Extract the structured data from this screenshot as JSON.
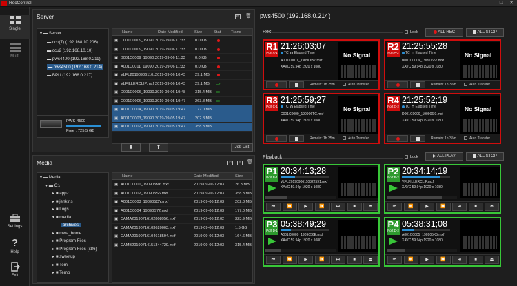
{
  "app": {
    "title": "RecControl"
  },
  "nav": {
    "single": "Single",
    "multi": "Multi",
    "settings": "Settings",
    "help": "Help",
    "exit": "Exit"
  },
  "server": {
    "title": "Server",
    "tree": [
      "Server",
      "ccu(7) (192.168.10.206)",
      "ccu2 (192.168.10.10)",
      "pws4400 (192.168.0.211)",
      "pws4500 (192.168.0.214)",
      "BPU (192.168.0.217)"
    ],
    "device_name": "PWS-4500",
    "device_free": "Free : 725.5 GB",
    "columns": [
      "Name",
      "Date Modified",
      "Size",
      "Stat",
      "Trans"
    ],
    "rows": [
      {
        "name": "D001C0009_19090...",
        "date": "2019-09-06 11:33",
        "size": "0.0 KB",
        "stat": "red",
        "sel": false
      },
      {
        "name": "C001C0009_19090...",
        "date": "2019-09-06 11:33",
        "size": "0.0 KB",
        "stat": "red",
        "sel": false
      },
      {
        "name": "B001C0009_19090...",
        "date": "2019-09-06 11:33",
        "size": "0.0 KB",
        "stat": "red",
        "sel": false
      },
      {
        "name": "A001C0011_19090...",
        "date": "2019-09-06 11:33",
        "size": "0.0 KB",
        "stat": "red",
        "sel": false
      },
      {
        "name": "VLFL20190906110...",
        "date": "2019-09-06 10:43",
        "size": "29.1 MB",
        "stat": "red",
        "sel": false
      },
      {
        "name": "VLFILLERCLIP.mxf",
        "date": "2019-09-06 10:43",
        "size": "29.1 MB",
        "stat": "green",
        "sel": false
      },
      {
        "name": "D001C0006_19090...",
        "date": "2019-09-06 19:48",
        "size": "315.4 MB",
        "stat": "green",
        "sel": false
      },
      {
        "name": "C001C0006_19090...",
        "date": "2019-09-05 19:47",
        "size": "263.8 MB",
        "stat": "green",
        "sel": false
      },
      {
        "name": "A001C0004_19090...",
        "date": "2019-09-05 19:47",
        "size": "177.0 MB",
        "stat": "",
        "sel": true
      },
      {
        "name": "A001C0003_19090...",
        "date": "2019-09-05 19:47",
        "size": "202.8 MB",
        "stat": "",
        "sel": true
      },
      {
        "name": "A001C0002_19090...",
        "date": "2019-09-05 19:47",
        "size": "358.3 MB",
        "stat": "",
        "sel": true
      }
    ],
    "down_arrow": "⬇",
    "up_arrow": "⬆",
    "job_list": "Job List"
  },
  "media": {
    "title": "Media",
    "tree": [
      "Media",
      "C:\\",
      "appz",
      "jenkins",
      "Logs",
      "media",
      "archives",
      "mwa_home",
      "Program Files",
      "Program Files (x86)",
      "swsetup",
      "Tem",
      "Temp"
    ],
    "columns": [
      "Name",
      "Date Modified",
      "Size"
    ],
    "rows": [
      {
        "name": "A001C0001_190905M6.mxf",
        "date": "2019-09-06 12:03",
        "size": "26.3 MB"
      },
      {
        "name": "A001C0002_190905S6.mxf",
        "date": "2019-09-06 12:03",
        "size": "358.3 MB"
      },
      {
        "name": "A001C0003_190905QY.mxf",
        "date": "2019-09-06 12:03",
        "size": "202.8 MB"
      },
      {
        "name": "A001C0004_19090S72.mxf",
        "date": "2019-09-06 12:03",
        "size": "177.0 MB"
      },
      {
        "name": "CAMA20190716102808956.mxf",
        "date": "2019-09-06 12:02",
        "size": "323.9 MB"
      },
      {
        "name": "CAMA20190716103620003.mxf",
        "date": "2019-09-06 12:03",
        "size": "1.5 GB"
      },
      {
        "name": "CAMA20190716104618594.mxf",
        "date": "2019-09-06 12:03",
        "size": "164.6 MB"
      },
      {
        "name": "CAMB20190714151344729.mxf",
        "date": "2019-09-06 12:03",
        "size": "315.4 MB"
      }
    ]
  },
  "device": {
    "title": "pws4500 (192.168.0.214)"
  },
  "rec": {
    "title": "Rec",
    "lock": "Lock",
    "all_rec": "ALL REC",
    "all_stop": "ALL STOP",
    "tc_label": "TC",
    "elapsed_label": "Elapsed Time",
    "auto_transfer": "Auto Transfer",
    "cards": [
      {
        "id": "R1",
        "port": "Port A-1",
        "timecode": "21:26;03;07",
        "file": "A001C0011_19090657.mxf",
        "format": "XAVC 59.94p 1920 x 1080",
        "signal": "No Signal",
        "remain": "Remain: 1h 35m"
      },
      {
        "id": "R2",
        "port": "Port A-2",
        "timecode": "21:25:55;28",
        "file": "B001C0009_19090657.mxf",
        "format": "XAVC 59.94p 1920 x 1080",
        "signal": "No Signal",
        "remain": "Remain: 1h 35m"
      },
      {
        "id": "R3",
        "port": "Port C-1",
        "timecode": "21:25:59;27",
        "file": "C001C0009_190906TC.mxf",
        "format": "XAVC 59.94p 1920 x 1080",
        "signal": "No Signal",
        "remain": "Remain: 1h 35m"
      },
      {
        "id": "R4",
        "port": "Port C-2",
        "timecode": "21:25:52;19",
        "file": "D001C0009_190906I0.mxf",
        "format": "XAVC 59.94p 1920 x 1080",
        "signal": "No Signal",
        "remain": "Remain: 1h 35m"
      }
    ]
  },
  "playback": {
    "title": "Playback",
    "lock": "Lock",
    "all_play": "ALL PLAY",
    "all_stop": "ALL STOP",
    "cards": [
      {
        "id": "P1",
        "port": "Port B-1",
        "timecode": "20:34:13;28",
        "file": "VLFL20190906110322591.mxf",
        "format": "XAVC 59.94p 1920 x 1080",
        "progress": 0.3
      },
      {
        "id": "P2",
        "port": "Port B-2",
        "timecode": "20:34:14;19",
        "file": "VFLFILLERCLIP.mxf",
        "format": "XAVC 59.94p 1920 x 1080",
        "progress": 0.78
      },
      {
        "id": "P3",
        "port": "Port D-1",
        "timecode": "05:38:49;29",
        "file": "A001C0009_1909056E.mxf",
        "format": "XAVC 59.94p 1920 x 1080",
        "progress": 0.22
      },
      {
        "id": "P4",
        "port": "Port D-2",
        "timecode": "05:38:31;08",
        "file": "A001C0005_190905K5.mxf",
        "format": "XAVC 59.94p 1920 x 1080",
        "progress": 0.26
      }
    ]
  },
  "colors": {
    "rec_accent": "#d00d0d",
    "play_accent": "#38c638",
    "selection": "#2a5b8c"
  }
}
